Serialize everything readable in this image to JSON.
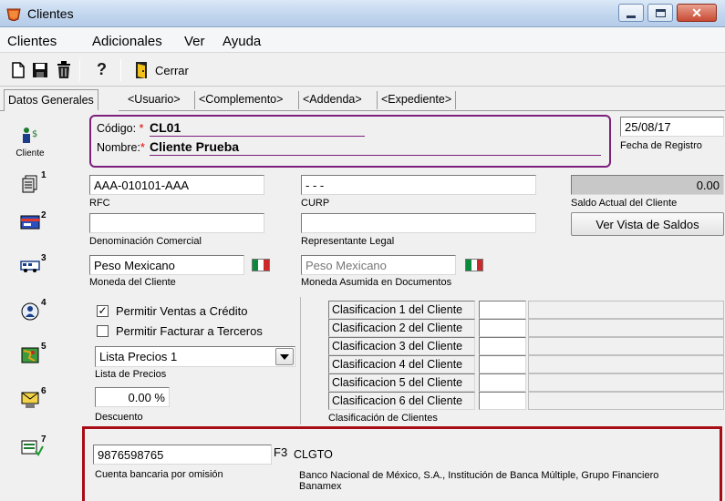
{
  "window": {
    "title": "Clientes"
  },
  "menu": [
    "Clientes",
    "Adicionales",
    "Ver",
    "Ayuda"
  ],
  "toolbar": {
    "close_label": "Cerrar"
  },
  "tabs": [
    "Datos Generales",
    "<Usuario>",
    "<Complemento>",
    "<Addenda>",
    "<Expediente>"
  ],
  "sidebar": {
    "cliente_label": "Cliente",
    "numbers": [
      "1",
      "2",
      "3",
      "4",
      "5",
      "6",
      "7"
    ]
  },
  "form": {
    "codigo_label": "Código:",
    "codigo_value": "CL01",
    "nombre_label": "Nombre:",
    "nombre_value": "Cliente Prueba",
    "required_mark": "*",
    "fecha_value": "25/08/17",
    "fecha_label": "Fecha de Registro",
    "rfc_value": "AAA-010101-AAA",
    "rfc_label": "RFC",
    "curp_value": "-       -       -",
    "curp_label": "CURP",
    "saldo_value": "0.00",
    "saldo_label": "Saldo Actual del Cliente",
    "ver_saldos_button": "Ver Vista de Saldos",
    "denominacion_value": "",
    "denominacion_label": "Denominación Comercial",
    "representante_value": "",
    "representante_label": "Representante Legal",
    "moneda_value": "Peso Mexicano",
    "moneda_label": "Moneda del Cliente",
    "moneda_asumida_value": "Peso Mexicano",
    "moneda_asumida_label": "Moneda Asumida en Documentos",
    "permitir_credito_label": "Permitir Ventas a Crédito",
    "permitir_credito_checked": true,
    "permitir_terceros_label": "Permitir Facturar a Terceros",
    "permitir_terceros_checked": false,
    "lista_precios_value": "Lista Precios 1",
    "lista_precios_label": "Lista de Precios",
    "descuento_value": "0.00 %",
    "descuento_label": "Descuento",
    "clasificaciones": [
      "Clasificacion 1 del Cliente",
      "Clasificacion 2 del Cliente",
      "Clasificacion 3 del Cliente",
      "Clasificacion 4 del Cliente",
      "Clasificacion 5 del Cliente",
      "Clasificacion 6 del Cliente"
    ],
    "clasificacion_label": "Clasificación de Clientes",
    "cuenta_value": "9876598765",
    "cuenta_label": "Cuenta bancaria por omisión",
    "f3_label": "F3",
    "banco_code": "CLGTO",
    "banco_name": "Banco Nacional de México, S.A., Institución de Banca Múltiple, Grupo Financiero Banamex"
  },
  "colors": {
    "purple_box": "#7c1f7c",
    "red_box": "#a80d16",
    "flag_green": "#0a8a3a",
    "flag_red": "#cc2a2a"
  }
}
